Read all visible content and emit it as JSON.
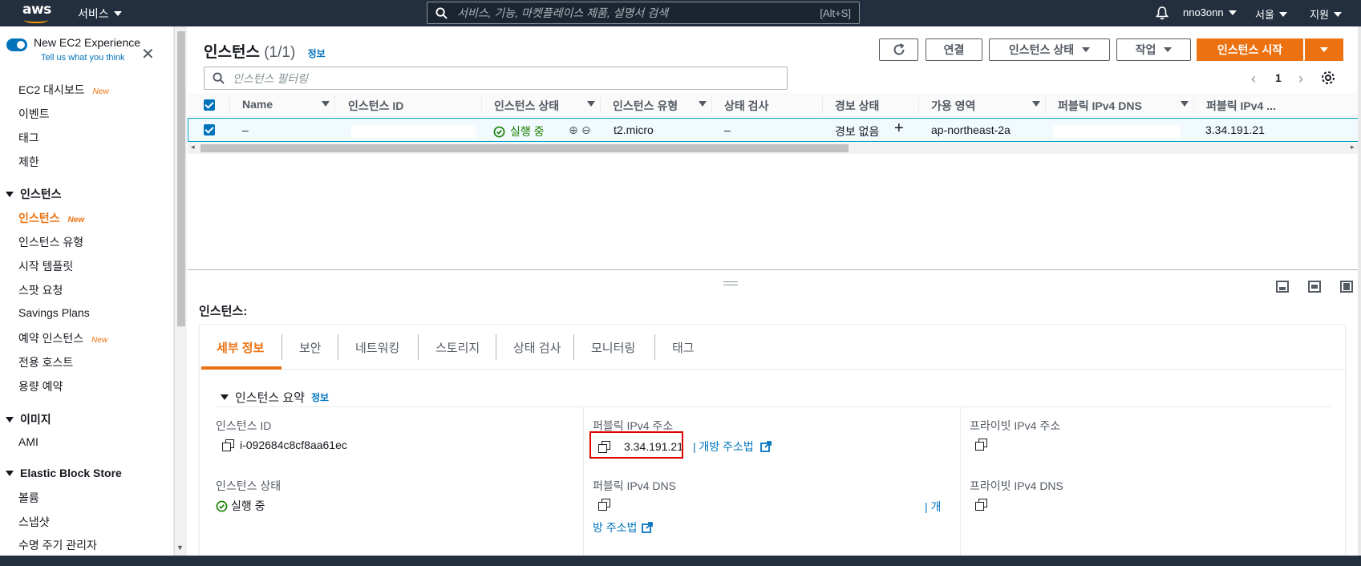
{
  "topnav": {
    "logo_text": "aws",
    "services": "서비스",
    "search_placeholder": "서비스, 기능, 마켓플레이스 제품, 설명서 검색",
    "search_shortcut": "[Alt+S]",
    "user": "nno3onn",
    "region": "서울",
    "support": "지원"
  },
  "sidebar": {
    "new_experience_title": "New EC2 Experience",
    "new_experience_sub": "Tell us what you think",
    "new_badge": "New",
    "links": [
      {
        "label": "EC2 대시보드",
        "new": true
      },
      {
        "label": "이벤트",
        "new": false
      },
      {
        "label": "태그",
        "new": false
      },
      {
        "label": "제한",
        "new": false
      }
    ],
    "section_instances": "인스턴스",
    "instance_links": [
      {
        "label": "인스턴스",
        "new": true
      },
      {
        "label": "인스턴스 유형",
        "new": false
      },
      {
        "label": "시작 템플릿",
        "new": false
      },
      {
        "label": "스팟 요청",
        "new": false
      },
      {
        "label": "Savings Plans",
        "new": false
      },
      {
        "label": "예약 인스턴스",
        "new": true
      },
      {
        "label": "전용 호스트",
        "new": false
      },
      {
        "label": "용량 예약",
        "new": false
      }
    ],
    "section_images": "이미지",
    "image_links": [
      {
        "label": "AMI"
      }
    ],
    "section_ebs": "Elastic Block Store",
    "ebs_links": [
      {
        "label": "볼륨"
      },
      {
        "label": "스냅샷"
      },
      {
        "label": "수명 주기 관리자"
      }
    ]
  },
  "instances": {
    "title": "인스턴스",
    "count": "(1/1)",
    "info": "정보",
    "btn_connect": "연결",
    "btn_state": "인스턴스 상태",
    "btn_actions": "작업",
    "btn_launch": "인스턴스 시작",
    "filter_placeholder": "인스턴스 필터링",
    "page": "1"
  },
  "table": {
    "columns": [
      "Name",
      "인스턴스 ID",
      "인스턴스 상태",
      "인스턴스 유형",
      "상태 검사",
      "경보 상태",
      "가용 영역",
      "퍼블릭 IPv4 DNS",
      "퍼블릭 IPv4 ..."
    ],
    "row": {
      "name": "–",
      "state": "실행 중",
      "type": "t2.micro",
      "status_check": "–",
      "alarm": "경보 없음",
      "az": "ap-northeast-2a",
      "public_ip": "3.34.191.21"
    }
  },
  "details": {
    "label": "인스턴스:",
    "tabs": [
      "세부 정보",
      "보안",
      "네트워킹",
      "스토리지",
      "상태 검사",
      "모니터링",
      "태그"
    ],
    "summary_title": "인스턴스 요약",
    "summary_info": "정보",
    "instance_id_label": "인스턴스 ID",
    "instance_id": "i-092684c8cf8aa61ec",
    "public_ipv4_label": "퍼블릭 IPv4 주소",
    "public_ipv4": "3.34.191.21",
    "open_address": "개방 주소법",
    "private_ipv4_label": "프라이빗 IPv4 주소",
    "state_label": "인스턴스 상태",
    "state": "실행 중",
    "public_dns_label": "퍼블릭 IPv4 DNS",
    "dns_open_1": "| 개",
    "dns_open_2": "방 주소법",
    "private_dns_label": "프라이빗 IPv4 DNS"
  }
}
